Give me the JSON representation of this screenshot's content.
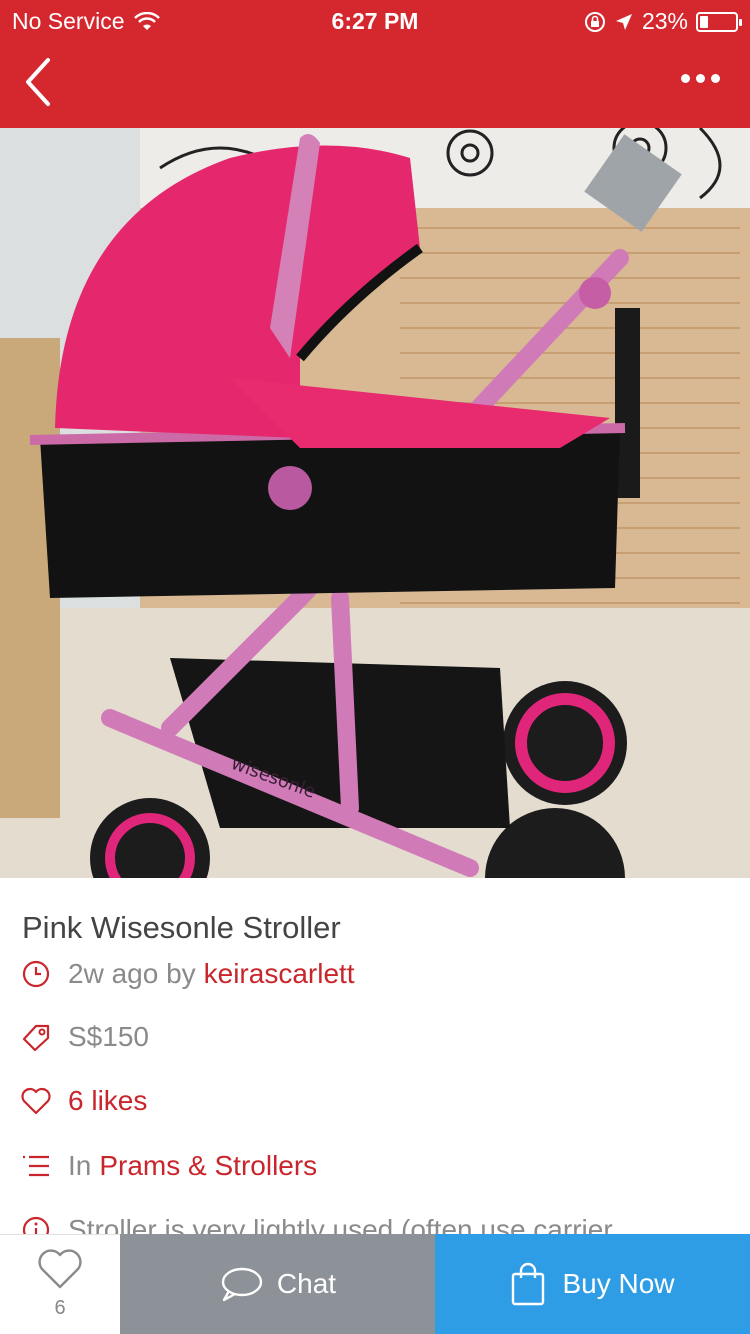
{
  "status_bar": {
    "carrier": "No Service",
    "time": "6:27 PM",
    "battery": "23%"
  },
  "header": {
    "back_icon": "chevron-left-icon",
    "more_icon": "more-dots-icon",
    "background_color": "#d5282e"
  },
  "listing": {
    "title": "Pink Wisesonle Stroller",
    "posted_ago": "2w ago by",
    "seller": "keirascarlett",
    "price": "S$150",
    "likes_text": "6 likes",
    "category_prefix": "In",
    "category": "Prams & Strollers",
    "description": "Stroller is very lightly used (often use carrier"
  },
  "photo": {
    "brand_text": "wisesonle"
  },
  "bottom_bar": {
    "like_count": "6",
    "chat_label": "Chat",
    "buy_label": "Buy Now",
    "chat_color": "#8d9198",
    "buy_color": "#2f9ce6"
  }
}
